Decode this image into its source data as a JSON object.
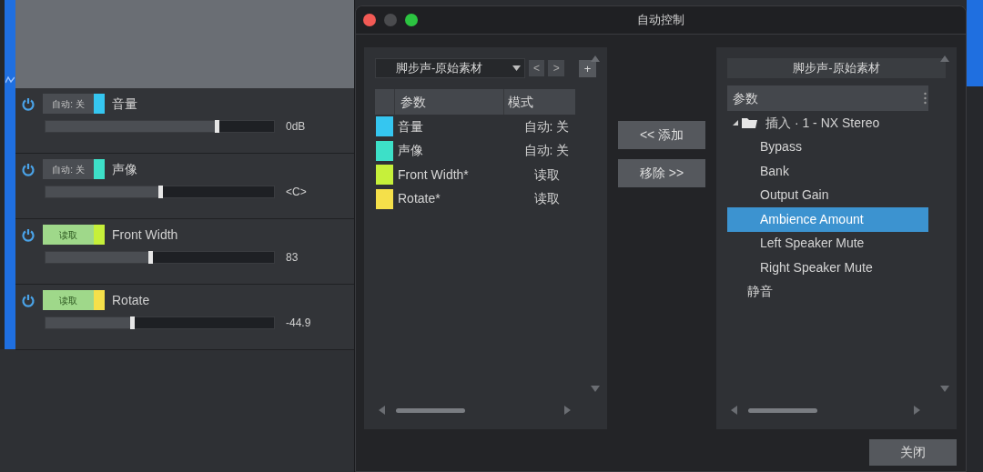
{
  "lanes": [
    {
      "mode": "自动: 关",
      "kind": "off",
      "color": "#35c6f0",
      "name": "音量",
      "level": 0.75,
      "reading": "0dB"
    },
    {
      "mode": "自动: 关",
      "kind": "off",
      "color": "#3de0c8",
      "name": "声像",
      "level": 0.5,
      "reading": "<C>"
    },
    {
      "mode": "读取",
      "kind": "read",
      "color": "#c6f03a",
      "name": "Front Width",
      "level": 0.46,
      "reading": "83"
    },
    {
      "mode": "读取",
      "kind": "read",
      "color": "#f5e04a",
      "name": "Rotate",
      "level": 0.38,
      "reading": "-44.9"
    }
  ],
  "dialog": {
    "title": "自动控制",
    "left": {
      "dropdown": "脚步声-原始素材",
      "prev": "<",
      "next": ">",
      "add": "+",
      "columns": [
        "参数",
        "模式"
      ],
      "rows": [
        {
          "color": "#35c6f0",
          "name": "音量",
          "mode": "自动: 关"
        },
        {
          "color": "#3de0c8",
          "name": "声像",
          "mode": "自动: 关"
        },
        {
          "color": "#c6f03a",
          "name": "Front Width*",
          "mode": "读取"
        },
        {
          "color": "#f5e04a",
          "name": "Rotate*",
          "mode": "读取"
        }
      ]
    },
    "buttons": [
      "<< 添加",
      "移除 >>"
    ],
    "right": {
      "header": "脚步声-原始素材",
      "column": "参数",
      "tree": [
        {
          "label": "插入 · 1 - NX Stereo",
          "expanded": true,
          "selected": false,
          "children": [
            {
              "label": "Bypass",
              "selected": false
            },
            {
              "label": "Bank",
              "selected": false
            },
            {
              "label": "Output Gain",
              "selected": false
            },
            {
              "label": "Ambience Amount",
              "selected": true
            },
            {
              "label": "Left Speaker Mute",
              "selected": false
            },
            {
              "label": "Right Speaker Mute",
              "selected": false
            }
          ]
        },
        {
          "label": "静音",
          "selected": false
        }
      ]
    },
    "close": "关闭"
  }
}
